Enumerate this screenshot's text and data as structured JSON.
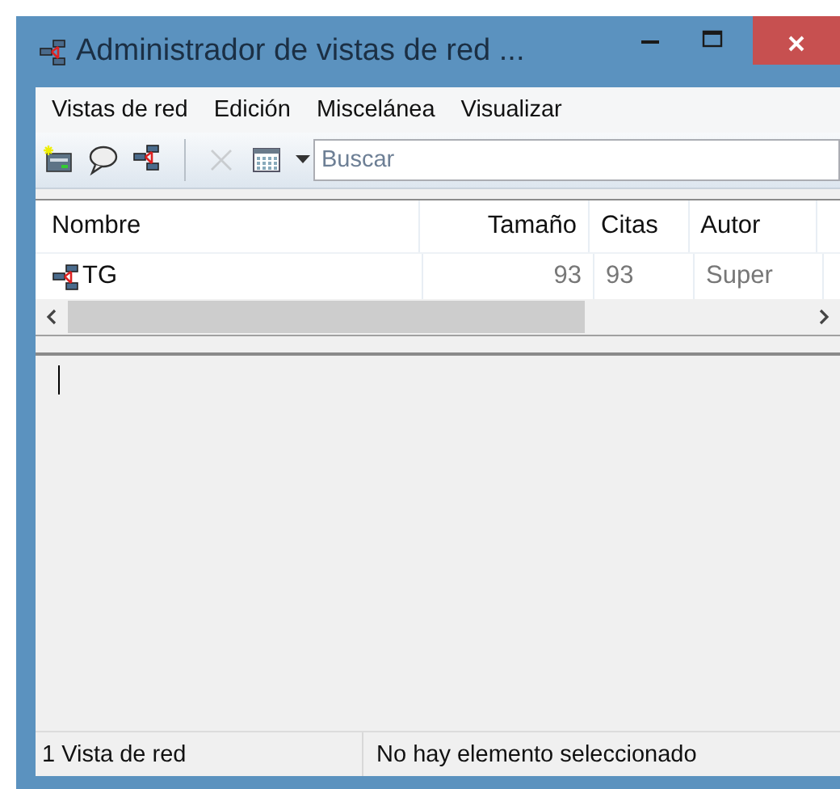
{
  "window": {
    "title": "Administrador de vistas de red ..."
  },
  "menu": [
    "Vistas de red",
    "Edición",
    "Miscelánea",
    "Visualizar"
  ],
  "toolbar": {
    "buttons": [
      {
        "kind": "new",
        "disabled": false
      },
      {
        "kind": "comment",
        "disabled": false
      },
      {
        "kind": "network",
        "disabled": false
      },
      {
        "kind": "separator"
      },
      {
        "kind": "delete",
        "disabled": true
      },
      {
        "kind": "calendar",
        "disabled": false
      }
    ],
    "search": {
      "placeholder": "Buscar"
    }
  },
  "table": {
    "columns": [
      {
        "label": "Nombre"
      },
      {
        "label": "Tamaño"
      },
      {
        "label": "Citas"
      },
      {
        "label": "Autor"
      }
    ],
    "rows": [
      {
        "cells": [
          "TG",
          "93",
          "93",
          "Super"
        ]
      }
    ]
  },
  "status_bar": [
    "1 Vista de red",
    "No hay elemento seleccionado"
  ]
}
